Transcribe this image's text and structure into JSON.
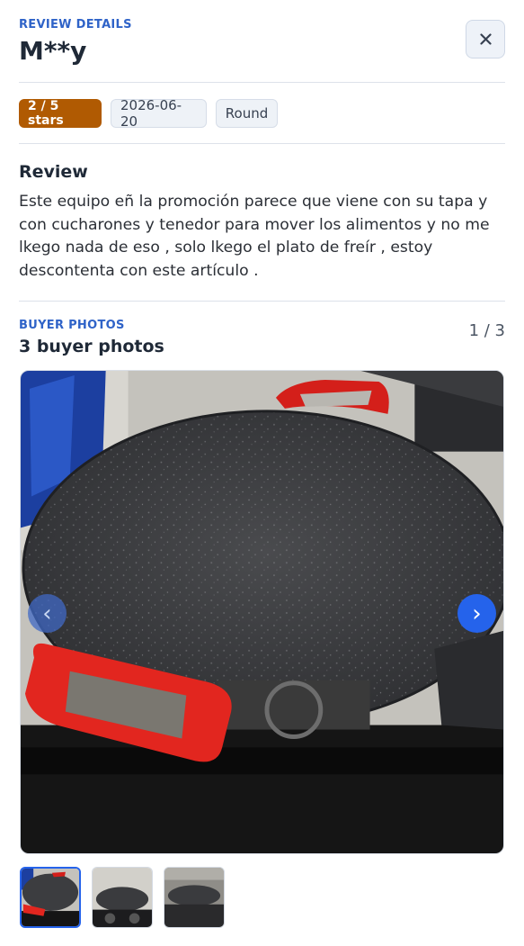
{
  "header": {
    "eyebrow": "REVIEW DETAILS",
    "reviewer": "M**y",
    "close_icon": "close-icon"
  },
  "meta": {
    "rating_label": "2 / 5 stars",
    "rating": {
      "value": 2,
      "max": 5
    },
    "date": "2026-06-20",
    "variant": "Round",
    "colors": {
      "rating_badge": "#b05a02"
    }
  },
  "review": {
    "heading": "Review",
    "body": "Este equipo eñ la promoción parece que viene con su tapa y con cucharones y tenedor para mover los alimentos y no me lkego nada de eso , solo lkego el plato de freír , estoy descontenta con este artículo ."
  },
  "photos": {
    "eyebrow": "BUYER PHOTOS",
    "title": "3 buyer photos",
    "counter": "1 / 3",
    "current": 1,
    "total": 3,
    "prev_icon": "chevron-left-icon",
    "next_icon": "chevron-right-icon",
    "prev_glyph": "‹",
    "next_glyph": "›",
    "colors": {
      "accent": "#2563eb"
    }
  }
}
